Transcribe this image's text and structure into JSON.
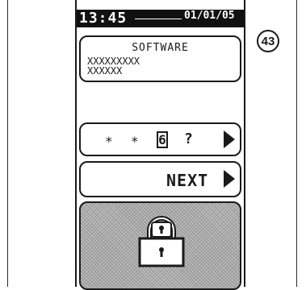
{
  "figure_number": "43",
  "status_bar": {
    "time": "13:45",
    "date": "01/01/05"
  },
  "software_panel": {
    "title": "SOFTWARE",
    "line1": "XXXXXXXXX",
    "line2": "XXXXXX"
  },
  "code_entry": {
    "char1": "*",
    "char2": "*",
    "current_digit": "6",
    "char4": "?"
  },
  "next_button": {
    "label": "NEXT"
  },
  "icons": {
    "code_arrow": "right-triangle-arrow-icon",
    "next_arrow": "right-triangle-arrow-icon",
    "lock": "padlock-icon"
  }
}
